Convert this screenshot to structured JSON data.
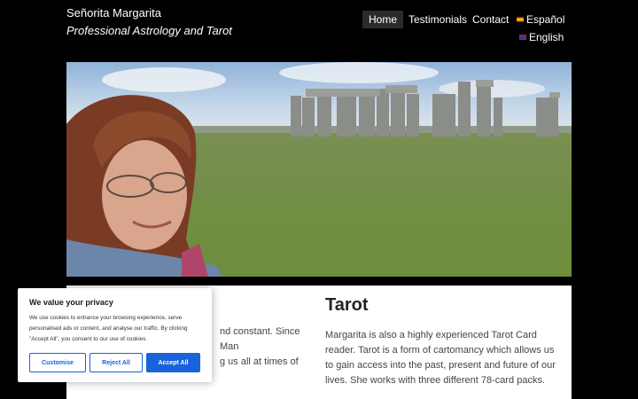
{
  "header": {
    "site_title": "Señorita Margarita",
    "tagline": "Professional Astrology and Tarot"
  },
  "nav": {
    "home": "Home",
    "testimonials": "Testimonials",
    "contact": "Contact",
    "espanol": "Español",
    "english": "English",
    "active": "Home"
  },
  "hero": {
    "description": "Photo of woman in front of Stonehenge"
  },
  "content": {
    "left_text_fragment": "nd constant. Since Man\ng us all at times of",
    "tarot_heading": "Tarot",
    "tarot_text": "Margarita is also a highly experienced Tarot Card reader. Tarot is a form of cartomancy which allows us to gain access into the past, present and future of our lives. She works with three different 78-card packs."
  },
  "cookie_banner": {
    "title": "We value your privacy",
    "text": "We use cookies to enhance your browsing experience, serve personalised ads or content, and analyse our traffic. By clicking \"Accept All\", you consent to our use of cookies.",
    "customise": "Customise",
    "reject": "Reject All",
    "accept": "Accept All"
  },
  "colors": {
    "accent": "#1863dc",
    "background": "#000000"
  }
}
